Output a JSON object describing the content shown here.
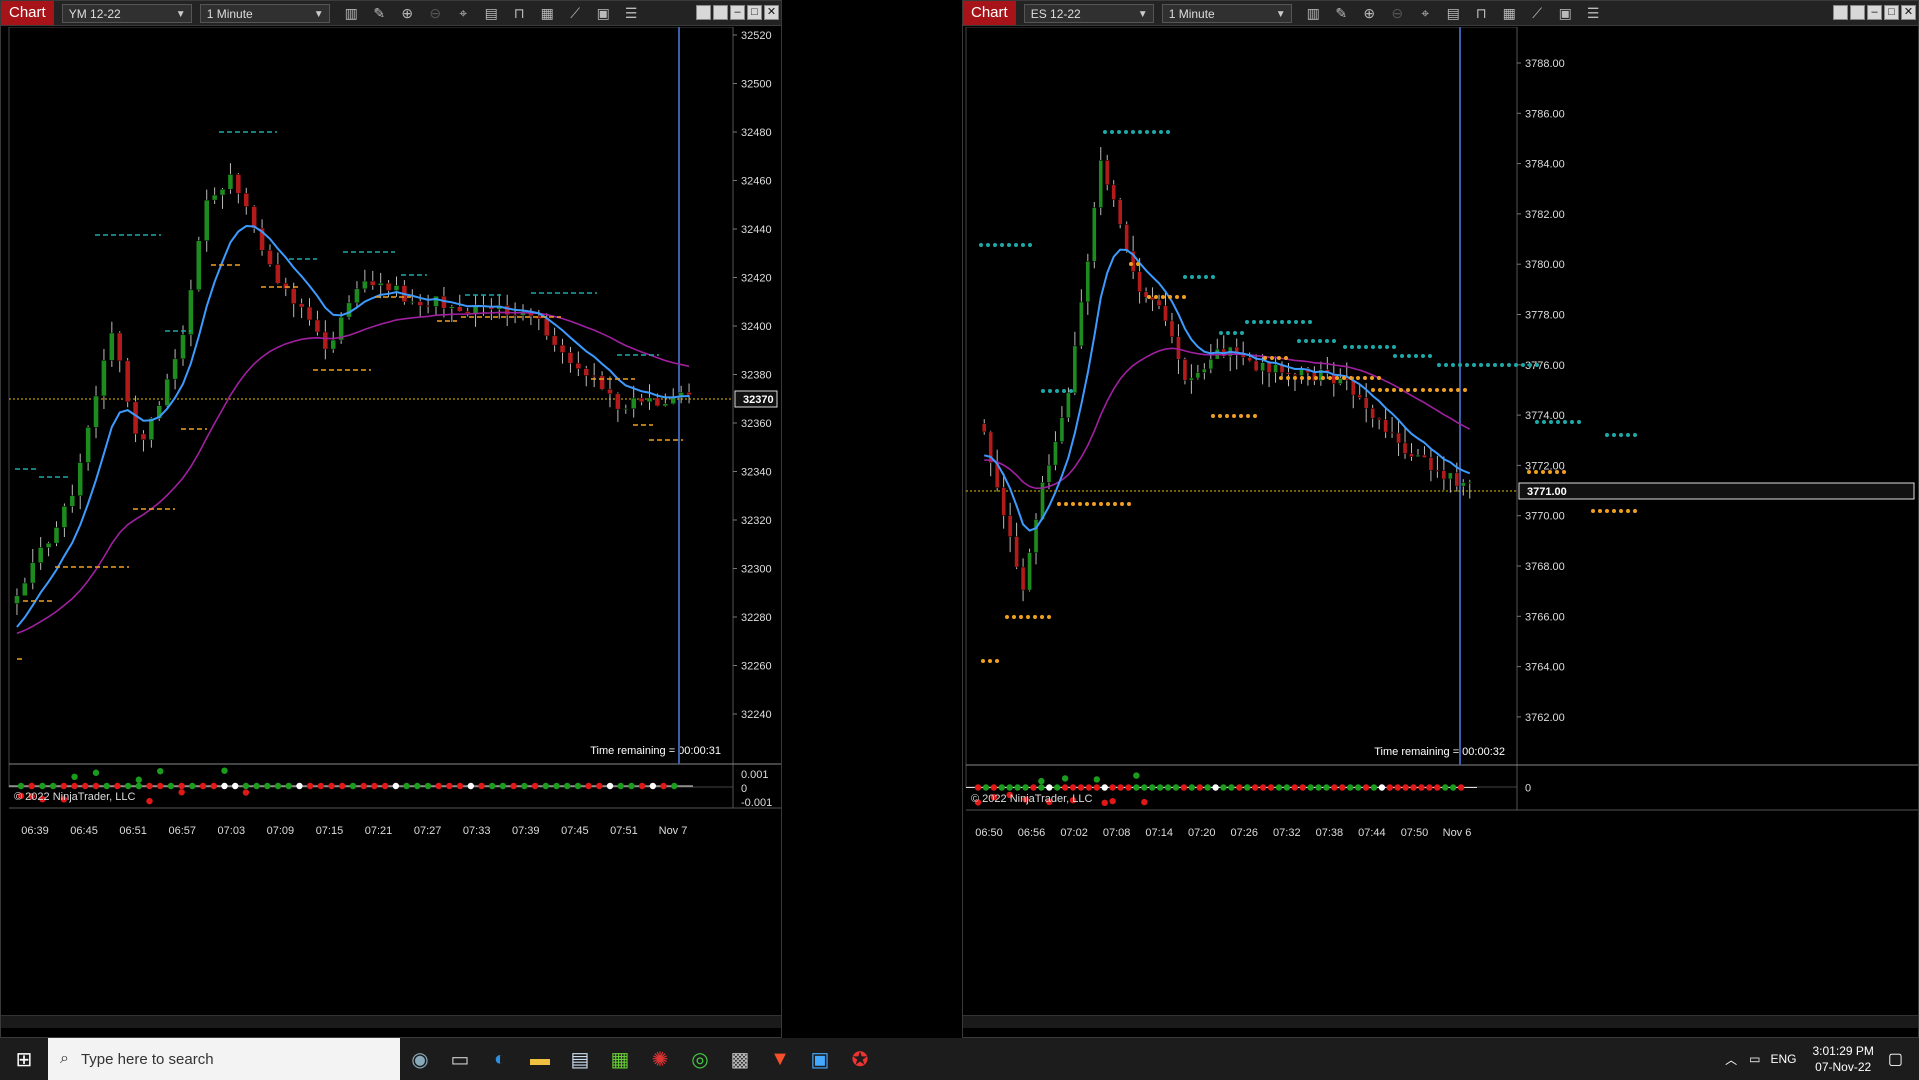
{
  "charts": [
    {
      "chart_label": "Chart",
      "instrument": "YM 12-22",
      "interval": "1 Minute",
      "time_remaining": "Time remaining = 00:00:31",
      "copyright": "© 2022 NinjaTrader, LLC",
      "price_marker": "32370",
      "price_ticks": [
        "32520",
        "32500",
        "32480",
        "32460",
        "32440",
        "32420",
        "32400",
        "32380",
        "32360",
        "32340",
        "32320",
        "32300",
        "32280",
        "32260",
        "32240"
      ],
      "osc_ticks": [
        "0.001",
        "0",
        "-0.001"
      ],
      "time_ticks": [
        "06:39",
        "06:45",
        "06:51",
        "06:57",
        "07:03",
        "07:09",
        "07:15",
        "07:21",
        "07:27",
        "07:33",
        "07:39",
        "07:45",
        "07:51",
        "Nov 7"
      ]
    },
    {
      "chart_label": "Chart",
      "instrument": "ES 12-22",
      "interval": "1 Minute",
      "time_remaining": "Time remaining = 00:00:32",
      "copyright": "© 2022 NinjaTrader, LLC",
      "price_marker": "3771.00",
      "price_ticks": [
        "3788.00",
        "3786.00",
        "3784.00",
        "3782.00",
        "3780.00",
        "3778.00",
        "3776.00",
        "3774.00",
        "3772.00",
        "3770.00",
        "3768.00",
        "3766.00",
        "3764.00",
        "3762.00"
      ],
      "osc_ticks": [
        "0"
      ],
      "time_ticks": [
        "06:50",
        "06:56",
        "07:02",
        "07:08",
        "07:14",
        "07:20",
        "07:26",
        "07:32",
        "07:38",
        "07:44",
        "07:50",
        "Nov 6"
      ]
    }
  ],
  "taskbar": {
    "search_placeholder": "Type here to search",
    "language": "ENG",
    "time": "3:01:29 PM",
    "date": "07-Nov-22"
  },
  "colors": {
    "up_candle": "#1e8b1e",
    "down_candle": "#b31b1b",
    "ema_fast": "#3d9bff",
    "ema_slow": "#a020a0",
    "resistance": "#1fa8a8",
    "support": "#f0a020",
    "price_line": "#e0c000",
    "cursor_line": "#3b5fa8"
  },
  "icons": {
    "toolbar": [
      "bars-type-icon",
      "draw-pencil-icon",
      "zoom-in-icon",
      "zoom-out-icon",
      "crosshair-icon",
      "data-box-icon",
      "indicators-icon",
      "strategies-icon",
      "chart-trader-icon",
      "properties-icon",
      "list-icon"
    ]
  }
}
